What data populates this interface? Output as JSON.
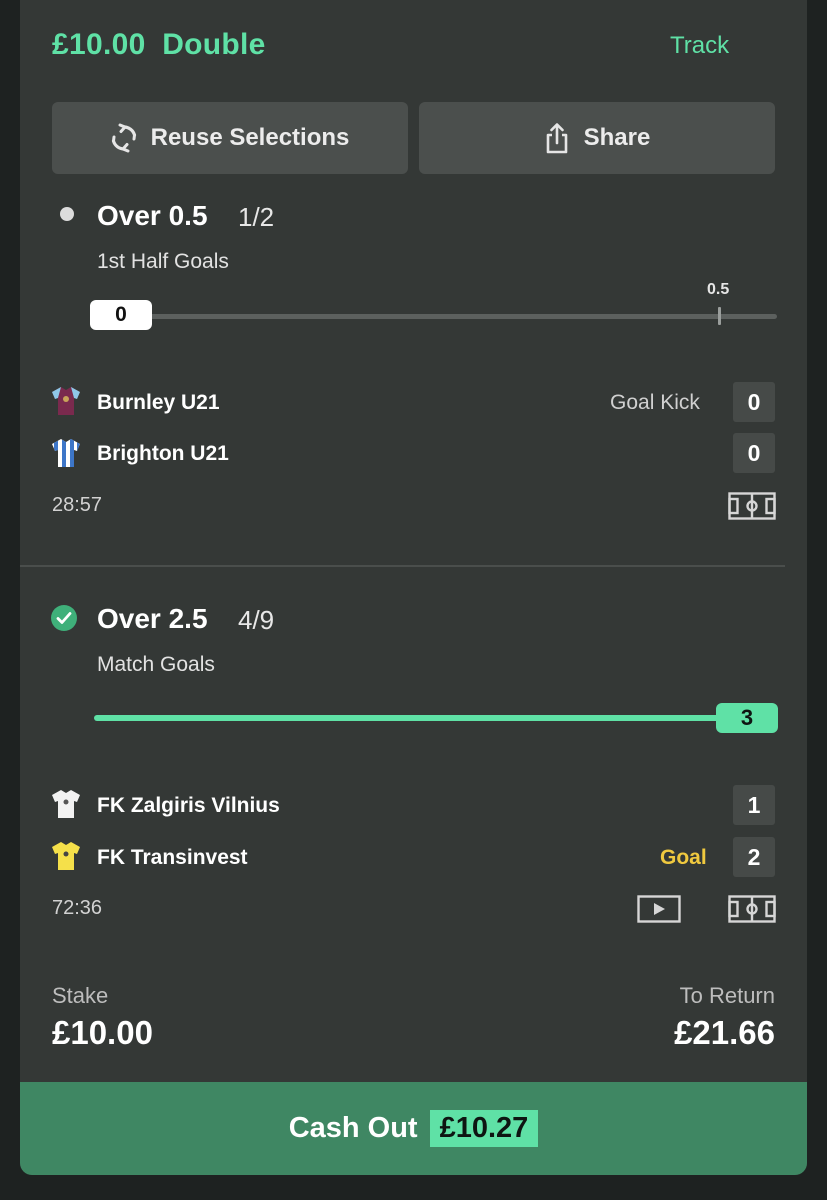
{
  "bet": {
    "stake_title": "£10.00",
    "type": "Double",
    "track_label": "Track"
  },
  "actions": {
    "reuse_label": "Reuse Selections",
    "share_label": "Share"
  },
  "selections": [
    {
      "name": "Over 0.5",
      "odds": "1/2",
      "market": "1st Half Goals",
      "status": "open",
      "progress": {
        "current_label": "0",
        "current": 0,
        "target": 0.5,
        "target_label": "0.5"
      },
      "home": {
        "team": "Burnley U21",
        "score": "0",
        "event": "Goal Kick",
        "shirt_color": "#7a2a4e",
        "sleeve_color": "#8fc7e8"
      },
      "away": {
        "team": "Brighton U21",
        "score": "0",
        "shirt_color": "#3d76c8",
        "stripe_color": "#ffffff"
      },
      "clock": "28:57",
      "icons": [
        "pitch-icon"
      ]
    },
    {
      "name": "Over 2.5",
      "odds": "4/9",
      "market": "Match Goals",
      "status": "won",
      "progress": {
        "current_label": "3",
        "current": 3,
        "target": 2.5
      },
      "home": {
        "team": "FK Zalgiris Vilnius",
        "score": "1",
        "shirt_color": "#ffffff"
      },
      "away": {
        "team": "FK Transinvest",
        "score": "2",
        "event": "Goal",
        "shirt_color": "#f5e04a"
      },
      "clock": "72:36",
      "icons": [
        "video-icon",
        "pitch-icon"
      ]
    }
  ],
  "summary": {
    "stake_label": "Stake",
    "stake_value": "£10.00",
    "return_label": "To Return",
    "return_value": "£21.66"
  },
  "cashout": {
    "label": "Cash Out",
    "amount": "£10.27"
  },
  "colors": {
    "accent": "#5fe1a6",
    "card": "#343836",
    "cashout": "#3f8763",
    "goal": "#f0c93f"
  }
}
